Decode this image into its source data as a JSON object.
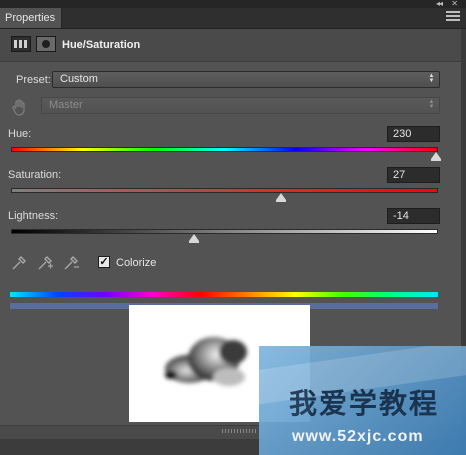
{
  "window": {
    "collapse_glyph": "◂◂",
    "close_glyph": "✕"
  },
  "tab": {
    "label": "Properties"
  },
  "header": {
    "title": "Hue/Saturation",
    "adjustment_icon": "adjustment-layer-icon",
    "mask_icon": "layer-mask-icon"
  },
  "preset": {
    "label": "Preset:",
    "value": "Custom"
  },
  "channel": {
    "value": "Master",
    "enabled": false,
    "tool_icon": "on-image-adjustment-hand-icon"
  },
  "hue": {
    "label": "Hue:",
    "value": "230",
    "min": -180,
    "max": 180
  },
  "saturation": {
    "label": "Saturation:",
    "value": "27",
    "min": -100,
    "max": 100
  },
  "lightness": {
    "label": "Lightness:",
    "value": "-14",
    "min": -100,
    "max": 100
  },
  "eyedroppers": [
    "eyedropper-icon",
    "eyedropper-plus-icon",
    "eyedropper-minus-icon"
  ],
  "colorize": {
    "checked": true,
    "check_glyph": "✓",
    "label": "Colorize"
  },
  "colors": {
    "panel_bg": "#535353",
    "hue_result": "#5a6e9c"
  },
  "watermark": {
    "title": "我爱学教程",
    "url": "www.52xjc.com"
  }
}
